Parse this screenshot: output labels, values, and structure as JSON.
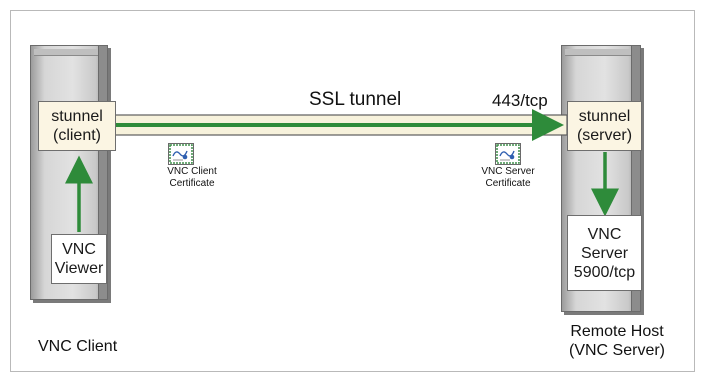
{
  "client": {
    "stunnel_line1": "stunnel",
    "stunnel_line2": "(client)",
    "viewer_line1": "VNC",
    "viewer_line2": "Viewer",
    "caption": "VNC Client"
  },
  "server": {
    "stunnel_line1": "stunnel",
    "stunnel_line2": "(server)",
    "vnc_line1": "VNC",
    "vnc_line2": "Server",
    "vnc_line3": "5900/tcp",
    "caption_line1": "Remote Host",
    "caption_line2": "(VNC Server)"
  },
  "tunnel": {
    "label": "SSL tunnel",
    "port": "443/tcp"
  },
  "certificates": {
    "client_line1": "VNC Client",
    "client_line2": "Certificate",
    "server_line1": "VNC Server",
    "server_line2": "Certificate"
  },
  "colors": {
    "arrow": "#2e8b3a",
    "tunnel_fill": "#f7f2dc",
    "box_fill": "#fbf5e3"
  }
}
